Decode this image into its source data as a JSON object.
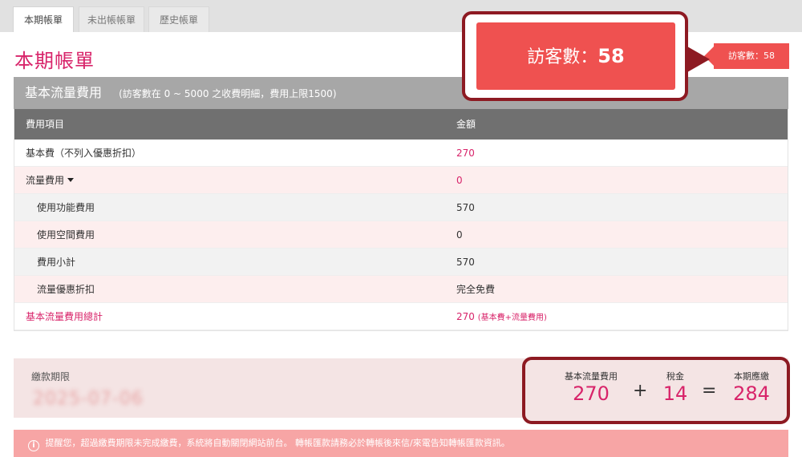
{
  "tabs": [
    {
      "label": "本期帳單"
    },
    {
      "label": "未出帳帳單"
    },
    {
      "label": "歷史帳單"
    }
  ],
  "page_title": "本期帳單",
  "visitor_badge": "訪客數：58",
  "visitor_callout": {
    "label": "訪客數：",
    "value": "58"
  },
  "section": {
    "title": "基本流量費用",
    "subtitle": "(訪客數在 0 ~ 5000 之收費明細，費用上限1500)"
  },
  "table": {
    "headers": [
      "費用項目",
      "金額"
    ],
    "rows": [
      {
        "item": "基本費（不列入優惠折扣）",
        "amount": "270"
      },
      {
        "item": "流量費用",
        "amount": "0"
      },
      {
        "item": "使用功能費用",
        "amount": "570"
      },
      {
        "item": "使用空間費用",
        "amount": "0"
      },
      {
        "item": "費用小計",
        "amount": "570"
      },
      {
        "item": "流量優惠折扣",
        "amount": "完全免費"
      },
      {
        "item": "基本流量費用總計",
        "amount": "270",
        "note": "(基本費+流量費用)"
      }
    ]
  },
  "payment": {
    "label": "繳款期限",
    "date": "2025-07-06"
  },
  "summary": {
    "base_label": "基本流量費用",
    "base_value": "270",
    "plus": "+",
    "tax_label": "稅金",
    "tax_value": "14",
    "equals": "=",
    "total_label": "本期應繳",
    "total_value": "284"
  },
  "notice": "提醒您，超過繳費期限未完成繳費，系統將自動關閉網站前台。 轉帳匯款請務必於轉帳後來信/來電告知轉帳匯款資訊。",
  "colors": {
    "accent": "#d8246a",
    "badge": "#ef5150",
    "callout_border": "#8d1a22"
  }
}
